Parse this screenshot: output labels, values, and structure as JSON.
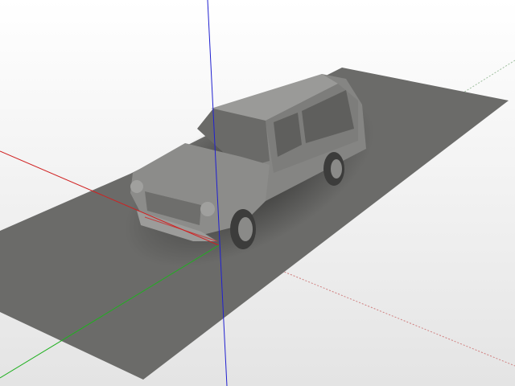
{
  "viewport": {
    "scene": "3d-car-model",
    "colors": {
      "ground": "#6b6b69",
      "car_body": "#8a8a88",
      "axis_x": "#d02020",
      "axis_y": "#20b020",
      "axis_z": "#2020d0"
    }
  }
}
